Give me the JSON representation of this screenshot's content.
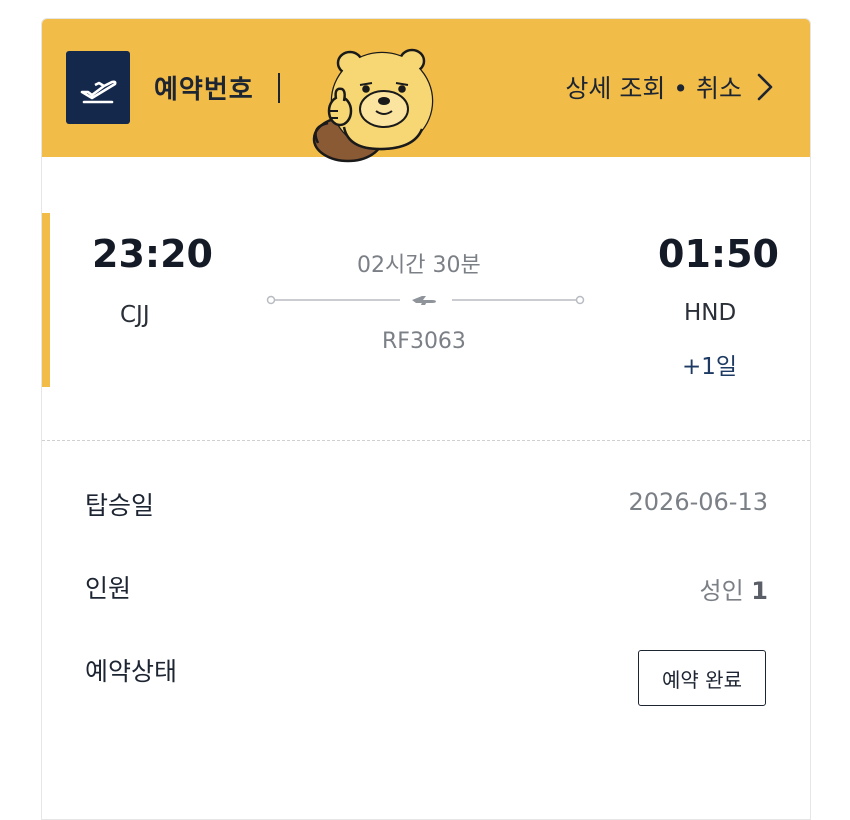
{
  "header": {
    "reservation_label": "예약번호",
    "detail_link": "상세 조회 • 취소",
    "background_color": "#f2bc48",
    "icon": "plane-takeoff-icon"
  },
  "flight": {
    "departure_time": "23:20",
    "departure_code": "CJJ",
    "arrival_time": "01:50",
    "arrival_code": "HND",
    "arrival_day_offset": "+1일",
    "duration": "02시간 30분",
    "flight_number": "RF3063"
  },
  "details": {
    "boarding_date_label": "탑승일",
    "boarding_date_value": "2026-06-13",
    "passengers_label": "인원",
    "passengers_type": "성인",
    "passengers_count": "1",
    "status_label": "예약상태",
    "status_value": "예약 완료"
  }
}
